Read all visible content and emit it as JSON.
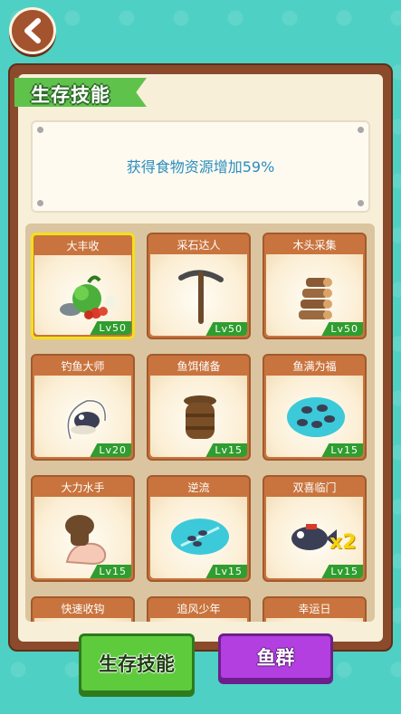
{
  "header": {
    "back_icon": "chevron-left-icon"
  },
  "panel": {
    "title": "生存技能",
    "description": "获得食物资源增加59%"
  },
  "skills": [
    {
      "name": "大丰收",
      "level": "Lv50",
      "icon": "vegetables-icon",
      "selected": true
    },
    {
      "name": "采石达人",
      "level": "Lv50",
      "icon": "pickaxe-icon"
    },
    {
      "name": "木头采集",
      "level": "Lv50",
      "icon": "logs-icon"
    },
    {
      "name": "钓鱼大师",
      "level": "Lv20",
      "icon": "fishing-icon"
    },
    {
      "name": "鱼饵储备",
      "level": "Lv15",
      "icon": "bait-jar-icon"
    },
    {
      "name": "鱼满为福",
      "level": "Lv15",
      "icon": "fish-school-icon"
    },
    {
      "name": "大力水手",
      "level": "Lv15",
      "icon": "strong-arm-icon"
    },
    {
      "name": "逆流",
      "level": "Lv15",
      "icon": "upstream-icon"
    },
    {
      "name": "双喜临门",
      "level": "Lv15",
      "icon": "double-fish-icon",
      "badge": "x2"
    },
    {
      "name": "快速收钩",
      "icon": "hook-icon"
    },
    {
      "name": "追风少年",
      "icon": "wind-icon"
    },
    {
      "name": "幸运日",
      "icon": "lucky-icon"
    }
  ],
  "tabs": {
    "survival": "生存技能",
    "fish": "鱼群"
  },
  "colors": {
    "background": "#4fd0c4",
    "panel": "#8a4a2b",
    "level_badge": "#2f9d2f",
    "selected_border": "#f5e017",
    "desc_text": "#2a8ec0"
  }
}
